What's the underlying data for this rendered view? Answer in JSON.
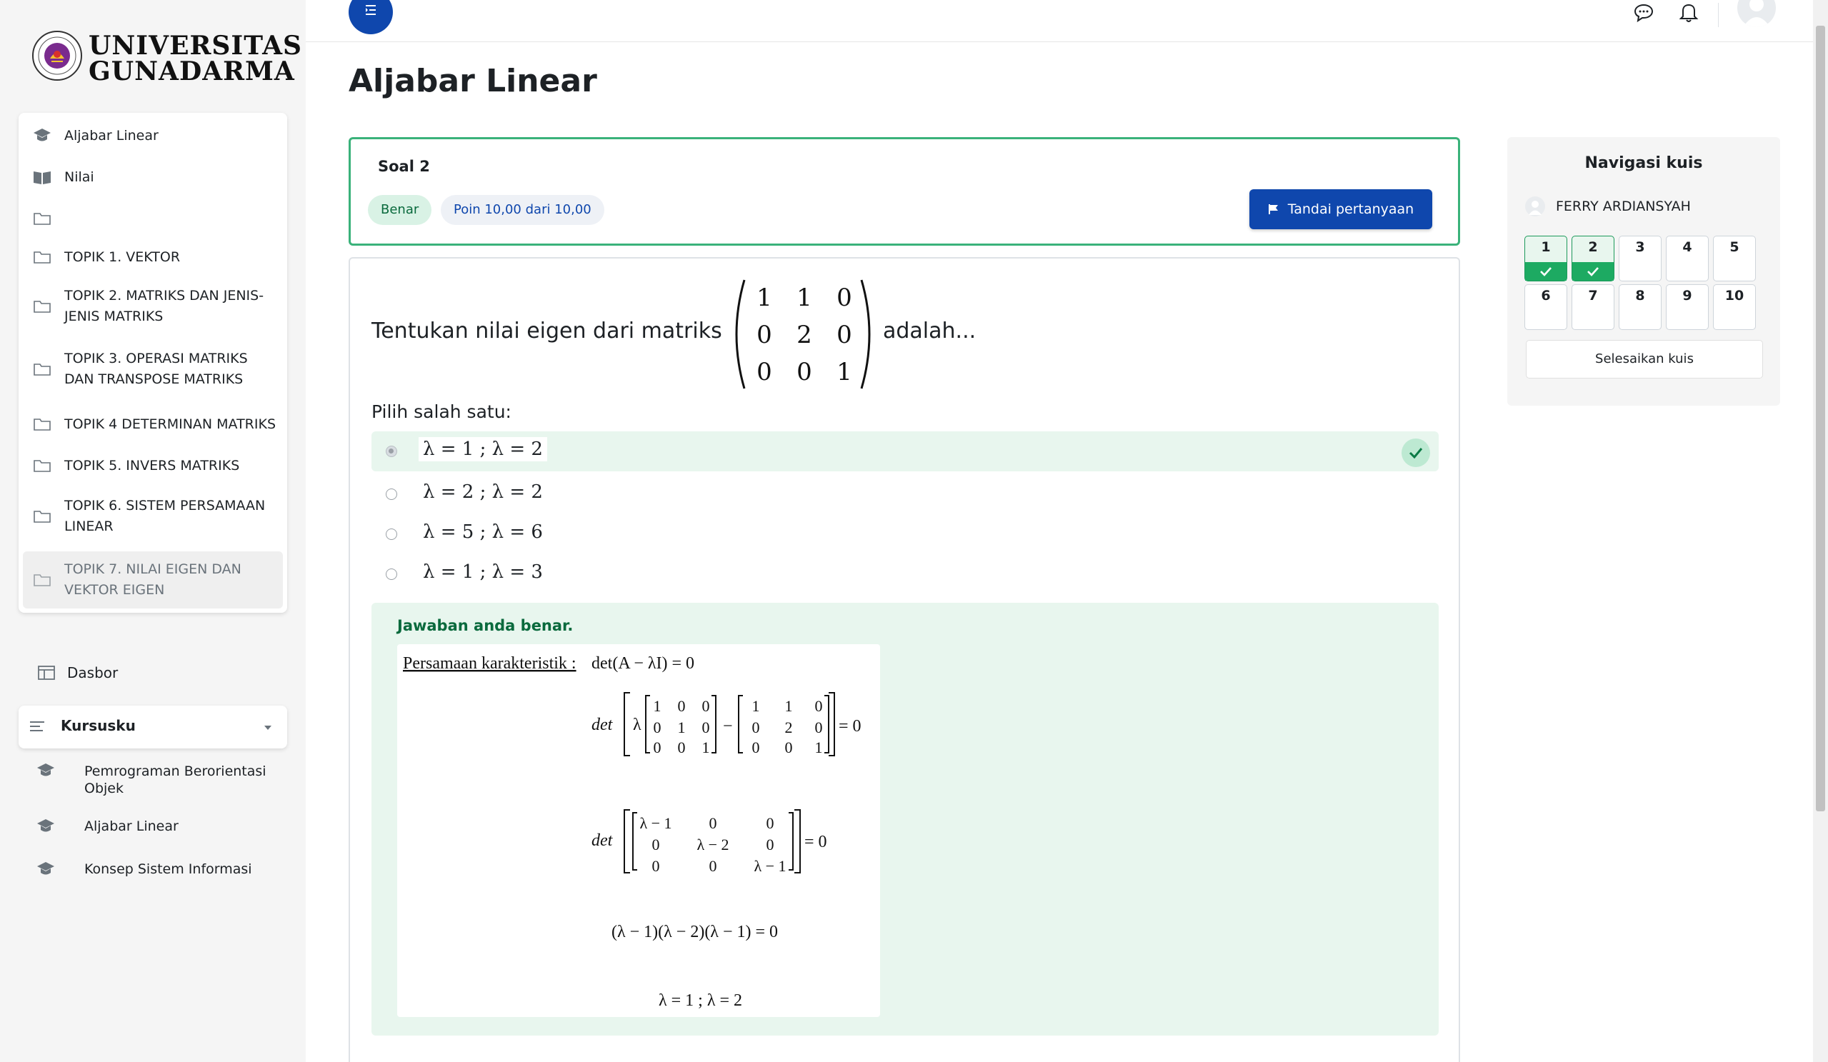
{
  "brand": {
    "line1": "UNIVERSITAS",
    "line2": "GUNADARMA"
  },
  "sidebar": {
    "course_items": [
      {
        "label": "Aljabar Linear",
        "icon": "graduation-cap-icon"
      },
      {
        "label": "Nilai",
        "icon": "book-icon"
      },
      {
        "label": "",
        "icon": "folder-icon"
      },
      {
        "label": "TOPIK 1. VEKTOR",
        "icon": "folder-icon"
      },
      {
        "label": "TOPIK 2. MATRIKS DAN JENIS-JENIS MATRIKS",
        "icon": "folder-icon"
      },
      {
        "label": "TOPIK 3. OPERASI MATRIKS DAN TRANSPOSE MATRIKS",
        "icon": "folder-icon"
      },
      {
        "label": "TOPIK 4 DETERMINAN MATRIKS",
        "icon": "folder-icon"
      },
      {
        "label": "TOPIK 5. INVERS MATRIKS",
        "icon": "folder-icon"
      },
      {
        "label": "TOPIK 6. SISTEM PERSAMAAN LINEAR",
        "icon": "folder-icon"
      },
      {
        "label": "TOPIK 7. NILAI EIGEN DAN VEKTOR EIGEN",
        "icon": "folder-icon"
      }
    ],
    "dashboard_label": "Dasbor",
    "mycourses_label": "Kursusku",
    "my_courses": [
      {
        "label": "Pemrograman Berorientasi Objek"
      },
      {
        "label": "Aljabar Linear"
      },
      {
        "label": "Konsep Sistem Informasi"
      }
    ]
  },
  "page": {
    "title": "Aljabar Linear"
  },
  "question": {
    "number_label": "Soal 2",
    "status_badge": "Benar",
    "points_badge": "Poin 10,00 dari 10,00",
    "flag_label": "Tandai pertanyaan",
    "text_before": "Tentukan nilai eigen dari matriks",
    "text_after": "adalah...",
    "matrix": [
      [
        "1",
        "1",
        "0"
      ],
      [
        "0",
        "2",
        "0"
      ],
      [
        "0",
        "0",
        "1"
      ]
    ],
    "prompt": "Pilih salah satu:",
    "options": [
      {
        "label": "λ = 1 ; λ = 2",
        "selected": true,
        "correct": true
      },
      {
        "label": "λ = 2 ; λ = 2",
        "selected": false
      },
      {
        "label": "λ = 5 ; λ = 6",
        "selected": false
      },
      {
        "label": "λ = 1 ; λ = 3",
        "selected": false
      }
    ],
    "feedback_title": "Jawaban anda benar.",
    "solution": {
      "line1_label": "Persamaan karakteristik :",
      "line1_expr": "det(A − λI)  =  0",
      "det_word": "det",
      "lambda": "λ",
      "identity": [
        [
          "1",
          "0",
          "0"
        ],
        [
          "0",
          "1",
          "0"
        ],
        [
          "0",
          "0",
          "1"
        ]
      ],
      "A": [
        [
          "1",
          "1",
          "0"
        ],
        [
          "0",
          "2",
          "0"
        ],
        [
          "0",
          "0",
          "1"
        ]
      ],
      "eq_zero": "= 0",
      "minus": "−",
      "char_matrix": [
        [
          "λ − 1",
          "0",
          "0"
        ],
        [
          "0",
          "λ − 2",
          "0"
        ],
        [
          "0",
          "0",
          "λ − 1"
        ]
      ],
      "factored": "(λ − 1)(λ − 2)(λ − 1) = 0",
      "result": "λ = 1 ; λ = 2"
    }
  },
  "quiz_nav": {
    "title": "Navigasi kuis",
    "user_name": "FERRY ARDIANSYAH",
    "buttons": [
      {
        "label": "1",
        "answered": true
      },
      {
        "label": "2",
        "answered": true
      },
      {
        "label": "3",
        "answered": false
      },
      {
        "label": "4",
        "answered": false
      },
      {
        "label": "5",
        "answered": false
      },
      {
        "label": "6",
        "answered": false
      },
      {
        "label": "7",
        "answered": false
      },
      {
        "label": "8",
        "answered": false
      },
      {
        "label": "9",
        "answered": false
      },
      {
        "label": "10",
        "answered": false
      }
    ],
    "finish_label": "Selesaikan kuis"
  },
  "colors": {
    "primary": "#0f47ad",
    "success": "#1daa62",
    "success_bg": "#e8f6ee",
    "sidebar_bg": "#f5f5f5"
  }
}
